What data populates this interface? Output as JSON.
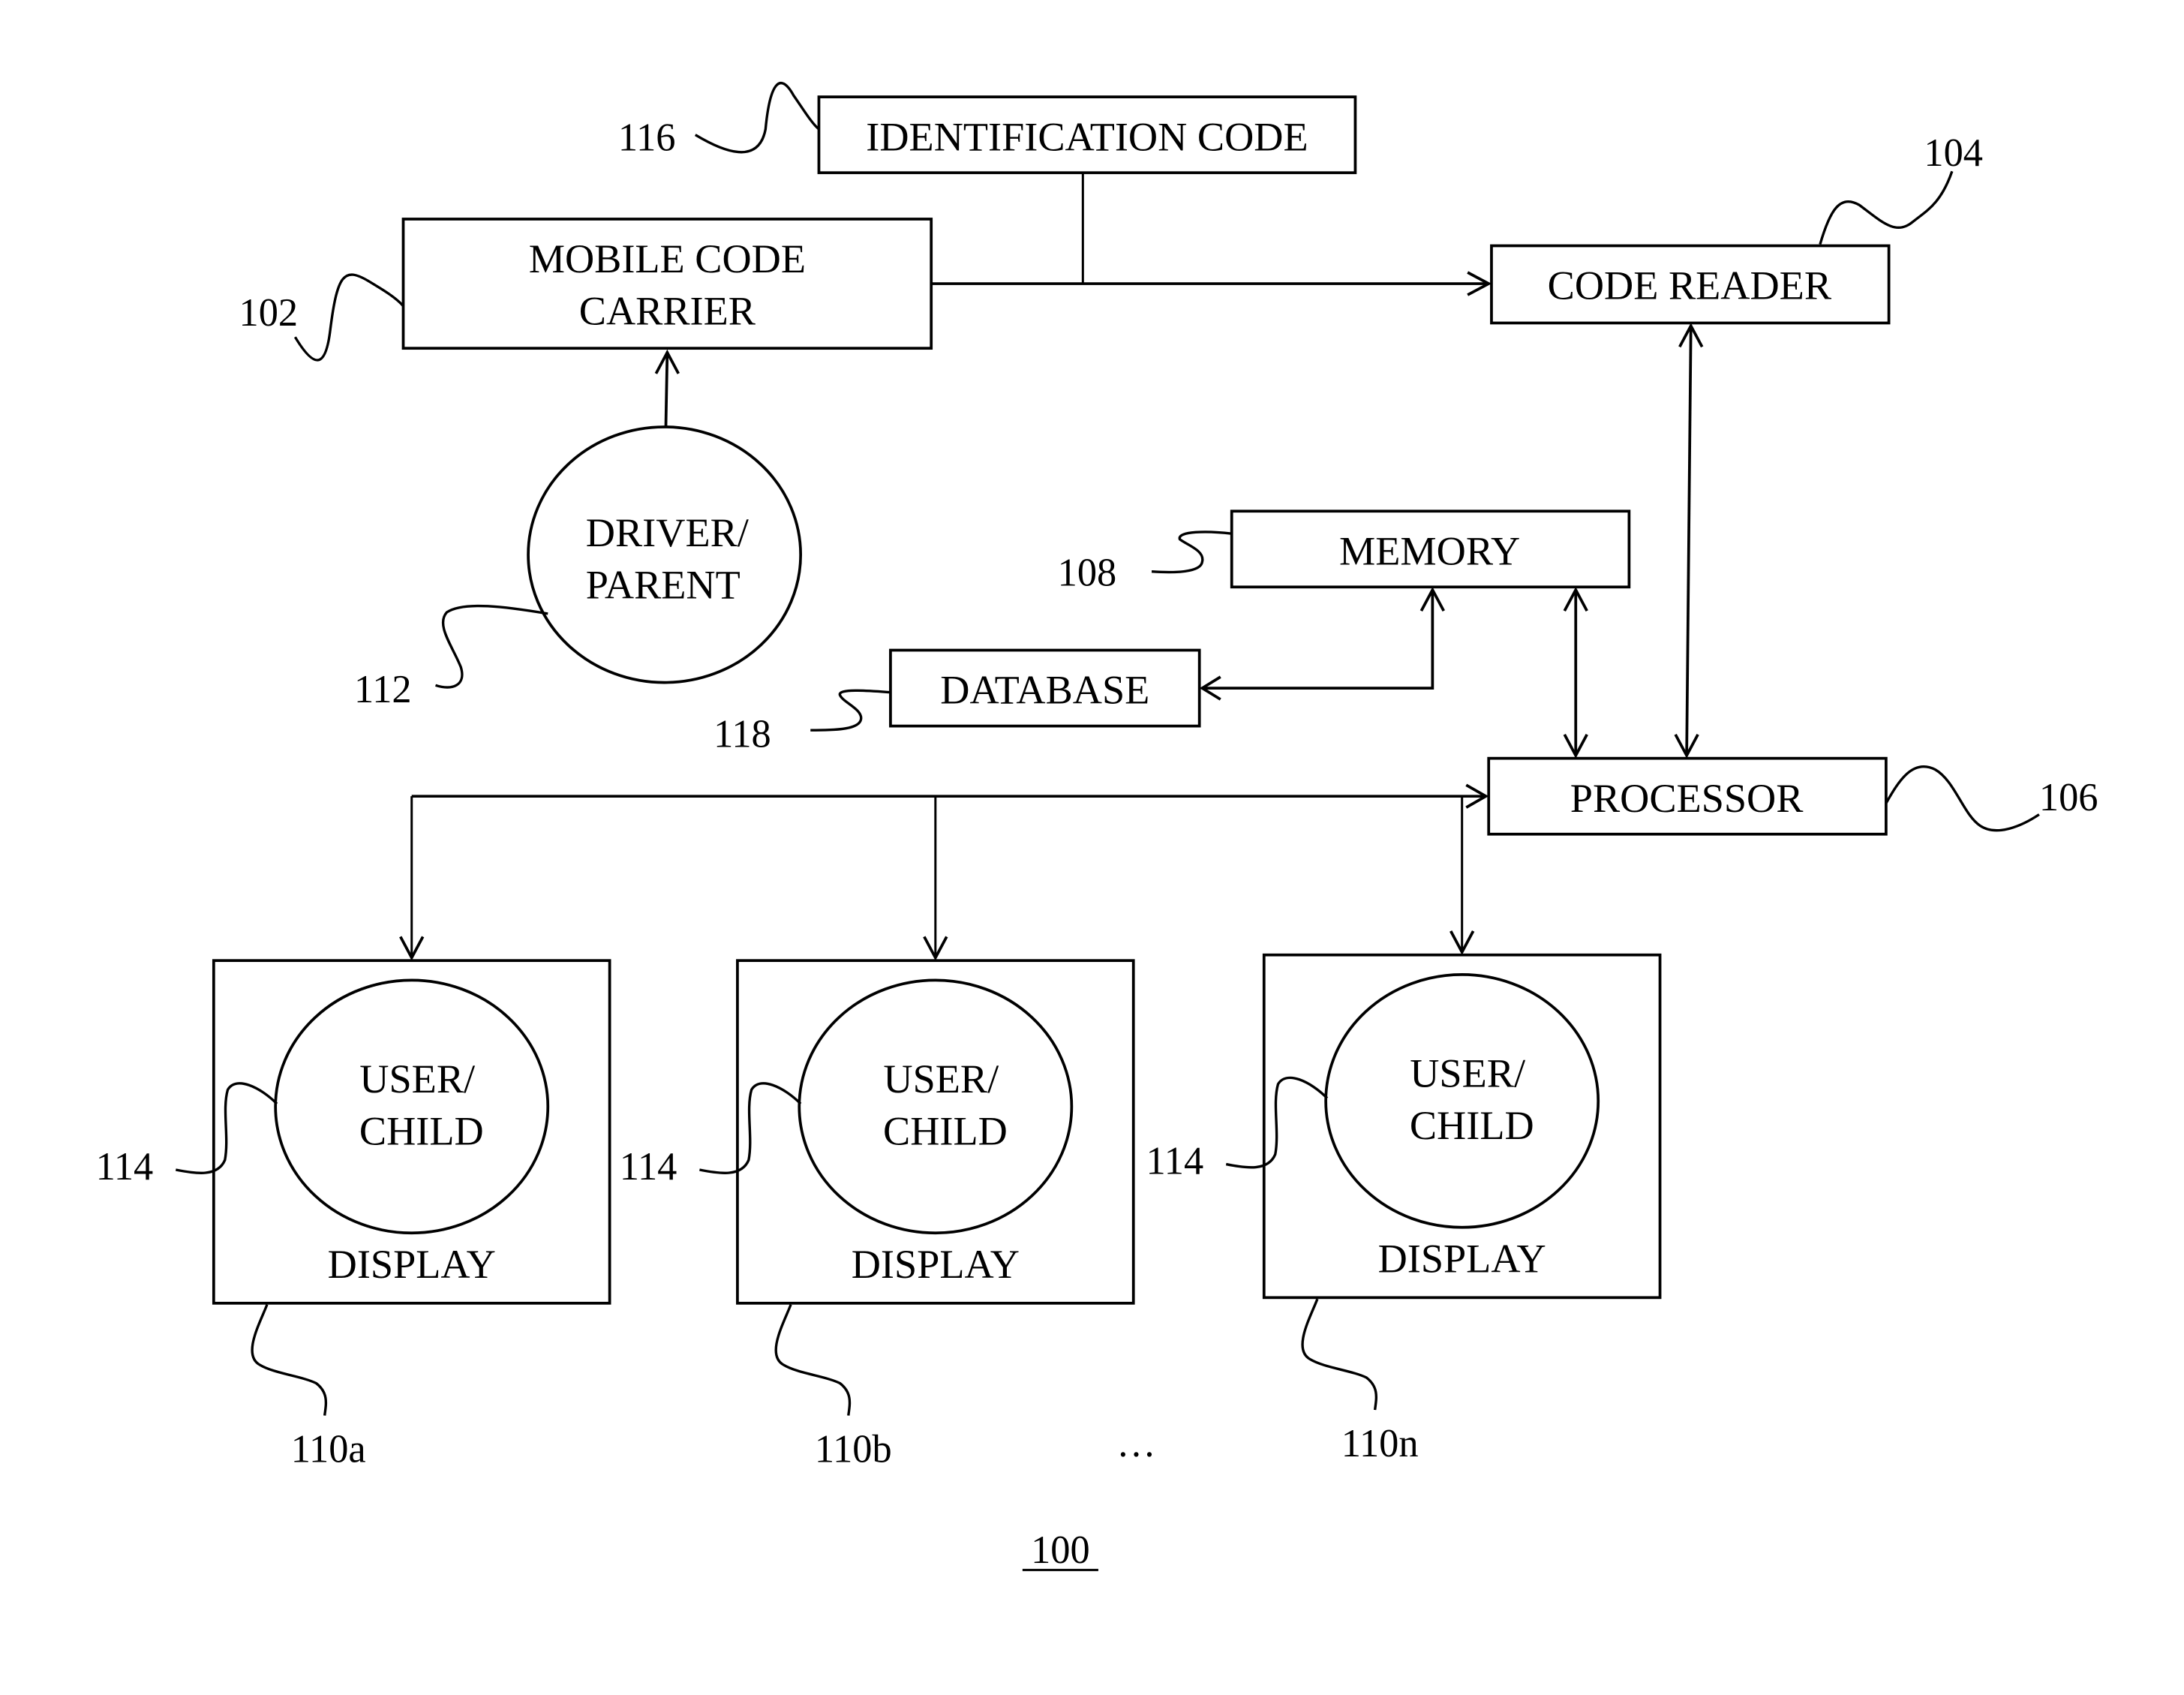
{
  "figure": {
    "number": "100",
    "ellipsis": "…"
  },
  "nodes": {
    "identification_code": {
      "label": [
        "IDENTIFICATION CODE"
      ],
      "ref": "116"
    },
    "mobile_code_carrier": {
      "label": [
        "MOBILE CODE",
        "CARRIER"
      ],
      "ref": "102"
    },
    "code_reader": {
      "label": [
        "CODE READER"
      ],
      "ref": "104"
    },
    "driver_parent": {
      "label": [
        "DRIVER/",
        "PARENT"
      ],
      "ref": "112"
    },
    "memory": {
      "label": [
        "MEMORY"
      ],
      "ref": "108"
    },
    "database": {
      "label": [
        "DATABASE"
      ],
      "ref": "118"
    },
    "processor": {
      "label": [
        "PROCESSOR"
      ],
      "ref": "106"
    },
    "displays": [
      {
        "label": "DISPLAY",
        "ref": "110a",
        "user": [
          "USER/",
          "CHILD"
        ],
        "user_ref": "114"
      },
      {
        "label": "DISPLAY",
        "ref": "110b",
        "user": [
          "USER/",
          "CHILD"
        ],
        "user_ref": "114"
      },
      {
        "label": "DISPLAY",
        "ref": "110n",
        "user": [
          "USER/",
          "CHILD"
        ],
        "user_ref": "114"
      }
    ]
  },
  "connections": [
    {
      "from": "identification_code",
      "to": "mobile_code_carrier",
      "type": "line"
    },
    {
      "from": "mobile_code_carrier",
      "to": "code_reader",
      "type": "arrow"
    },
    {
      "from": "driver_parent",
      "to": "mobile_code_carrier",
      "type": "arrow"
    },
    {
      "from": "code_reader",
      "to": "processor",
      "type": "bidirectional"
    },
    {
      "from": "memory",
      "to": "processor",
      "type": "bidirectional"
    },
    {
      "from": "memory",
      "to": "database",
      "type": "bidirectional"
    },
    {
      "from": "processor",
      "to": "displays",
      "type": "bidirectional"
    }
  ]
}
